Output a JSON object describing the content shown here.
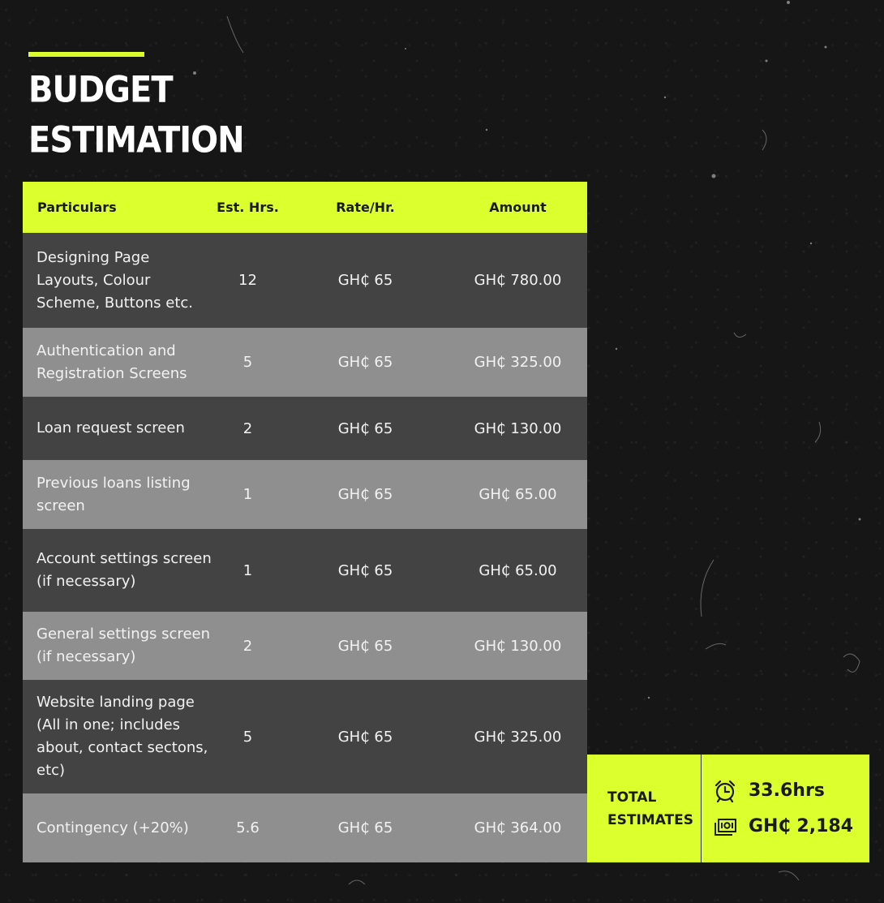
{
  "title": {
    "line1": "BUDGET",
    "line2": "ESTIMATION"
  },
  "table": {
    "headers": {
      "particulars": "Particulars",
      "hours": "Est. Hrs.",
      "rate": "Rate/Hr.",
      "amount": "Amount"
    },
    "rows": [
      {
        "particular": "Designing Page Layouts, Colour Scheme, Buttons etc.",
        "hours": "12",
        "rate": "GH₵ 65",
        "amount": "GH₵ 780.00"
      },
      {
        "particular": "Authentication and Registration Screens",
        "hours": "5",
        "rate": "GH₵ 65",
        "amount": "GH₵ 325.00"
      },
      {
        "particular": "Loan request screen",
        "hours": "2",
        "rate": "GH₵ 65",
        "amount": "GH₵ 130.00"
      },
      {
        "particular": "Previous loans listing screen",
        "hours": "1",
        "rate": "GH₵ 65",
        "amount": "GH₵ 65.00"
      },
      {
        "particular": "Account settings screen (if necessary)",
        "hours": "1",
        "rate": "GH₵ 65",
        "amount": "GH₵ 65.00"
      },
      {
        "particular": "General settings screen (if necessary)",
        "hours": "2",
        "rate": "GH₵ 65",
        "amount": "GH₵ 130.00"
      },
      {
        "particular": "Website landing page (All in one; includes about, contact sectons, etc)",
        "hours": "5",
        "rate": "GH₵ 65",
        "amount": "GH₵ 325.00"
      },
      {
        "particular": "Contingency (+20%)",
        "hours": "5.6",
        "rate": "GH₵ 65",
        "amount": "GH₵ 364.00"
      }
    ]
  },
  "totals": {
    "label": "TOTAL ESTIMATES",
    "hours": "33.6hrs",
    "amount": "GH₵ 2,184",
    "hours_icon": "alarm-clock-icon",
    "amount_icon": "money-icon"
  },
  "colors": {
    "accent": "#dcff2e",
    "background": "#161616",
    "row_dark": "#434343",
    "row_light": "#8f8f8f"
  }
}
